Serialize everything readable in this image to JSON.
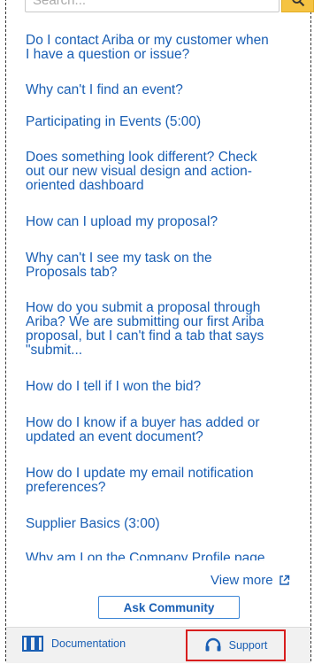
{
  "search": {
    "placeholder": "Search..."
  },
  "faq": {
    "items": [
      {
        "lines": [
          "Do I contact Ariba or my customer when",
          "I have a question or issue?"
        ]
      },
      {
        "lines": [
          "Why can't I find an event?"
        ]
      },
      {
        "lines": [
          "Participating in Events (5:00)"
        ]
      },
      {
        "lines": [
          "Does something look different? Check",
          "out our new visual design and action-",
          "oriented dashboard"
        ]
      },
      {
        "lines": [
          "How can I upload my proposal?"
        ]
      },
      {
        "lines": [
          "Why can't I see my task on the",
          "Proposals tab?"
        ]
      },
      {
        "lines": [
          "How do you submit a proposal through",
          "Ariba? We are submitting our first Ariba",
          "proposal, but I can't find a tab that says",
          "\"submit..."
        ]
      },
      {
        "lines": [
          "How do I tell if I won the bid?"
        ]
      },
      {
        "lines": [
          "How do I know if a buyer has added or",
          "updated an event document?"
        ]
      },
      {
        "lines": [
          "How do I update my email notification",
          "preferences?"
        ]
      },
      {
        "lines": [
          "Supplier Basics (3:00)"
        ]
      },
      {
        "lines": [
          "Why am I on the Company Profile page"
        ]
      }
    ]
  },
  "actions": {
    "view_more": "View more",
    "ask_community": "Ask Community"
  },
  "bottom_bar": {
    "documentation": "Documentation",
    "support": "Support"
  },
  "colors": {
    "link": "#1a5fb4",
    "search_button": "#f5c342",
    "highlight_border": "#d81e1e"
  },
  "icons": {
    "search": "magnifier-icon",
    "view_more": "external-link-icon",
    "documentation": "book-icon",
    "support": "headset-icon"
  }
}
